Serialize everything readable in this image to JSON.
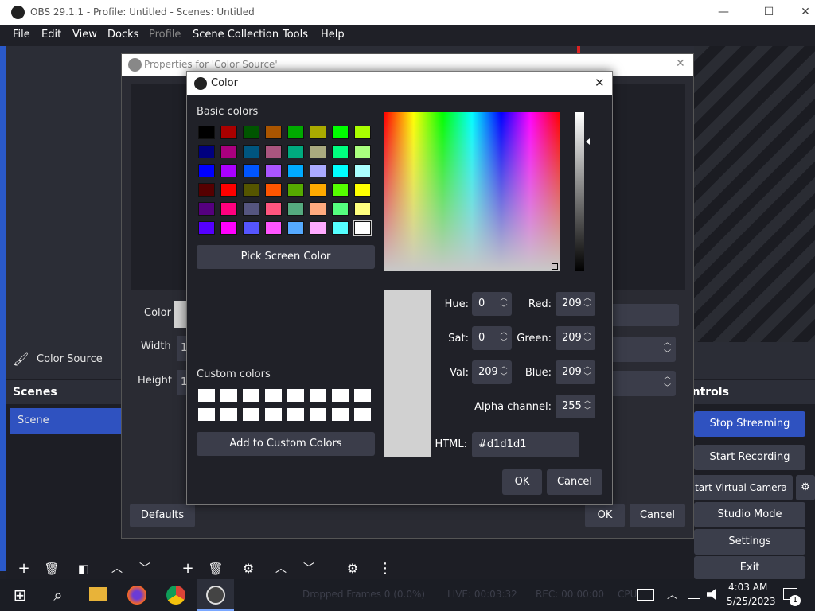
{
  "app": {
    "title": "OBS 29.1.1 - Profile: Untitled - Scenes: Untitled"
  },
  "menu": [
    "File",
    "Edit",
    "View",
    "Docks",
    "Profile",
    "Scene Collection",
    "Tools",
    "Help"
  ],
  "sources": {
    "active_source": "Color Source"
  },
  "scenes": {
    "header": "Scenes",
    "items": [
      "Scene"
    ]
  },
  "controls": {
    "header": "ontrols",
    "stop_streaming": "Stop Streaming",
    "start_recording": "Start Recording",
    "virtual_camera": "tart Virtual Camera",
    "studio_mode": "Studio Mode",
    "settings": "Settings",
    "exit": "Exit"
  },
  "status": {
    "dropped_frames": "Dropped Frames 0 (0.0%)",
    "live": "LIVE: 00:03:32",
    "rec": "REC: 00:00:00",
    "cpu": "CPU"
  },
  "properties": {
    "title": "Properties for 'Color Source'",
    "color_label": "Color",
    "width_label": "Width",
    "width_value": "1",
    "height_label": "Height",
    "height_value": "1",
    "defaults": "Defaults",
    "ok": "OK",
    "cancel": "Cancel"
  },
  "color_dialog": {
    "title": "Color",
    "basic_colors_label": "Basic colors",
    "basic_colors": [
      "#000000",
      "#aa0000",
      "#005500",
      "#aa5500",
      "#00aa00",
      "#aaaa00",
      "#00ff00",
      "#aaff00",
      "#00007f",
      "#aa007f",
      "#00557f",
      "#aa557f",
      "#00aa7f",
      "#aaaa7f",
      "#00ff7f",
      "#aaff7f",
      "#0000ff",
      "#aa00ff",
      "#0055ff",
      "#aa55ff",
      "#00aaff",
      "#aaaaff",
      "#00ffff",
      "#aaffff",
      "#550000",
      "#ff0000",
      "#555500",
      "#ff5500",
      "#55aa00",
      "#ffaa00",
      "#55ff00",
      "#ffff00",
      "#55007f",
      "#ff007f",
      "#55557f",
      "#ff557f",
      "#55aa7f",
      "#ffaa7f",
      "#55ff7f",
      "#ffff7f",
      "#5500ff",
      "#ff00ff",
      "#5555ff",
      "#ff55ff",
      "#55aaff",
      "#ffaaff",
      "#55ffff",
      "#ffffff"
    ],
    "pick_screen_color": "Pick Screen Color",
    "custom_colors_label": "Custom colors",
    "add_custom": "Add to Custom Colors",
    "hue_label": "Hue:",
    "hue": "0",
    "sat_label": "Sat:",
    "sat": "0",
    "val_label": "Val:",
    "val": "209",
    "red_label": "Red:",
    "red": "209",
    "green_label": "Green:",
    "green": "209",
    "blue_label": "Blue:",
    "blue": "209",
    "alpha_label": "Alpha channel:",
    "alpha": "255",
    "html_label": "HTML:",
    "html_value": "#d1d1d1",
    "current_color": "#d1d1d1",
    "ok": "OK",
    "cancel": "Cancel"
  },
  "taskbar": {
    "time": "4:03 AM",
    "date": "5/25/2023",
    "notification_count": "1"
  },
  "icons": {
    "window_minimize": "—",
    "window_maximize": "☐",
    "window_close": "✕",
    "dialog_close": "✕",
    "add": "+",
    "trash": "🗑",
    "filter": "◧",
    "up": "︿",
    "down": "﹀",
    "gear": "⚙",
    "more": "⋮",
    "brush": "🖌",
    "windows": "⊞",
    "search": "⌕",
    "spin_up": "︿",
    "spin_down": "﹀"
  }
}
